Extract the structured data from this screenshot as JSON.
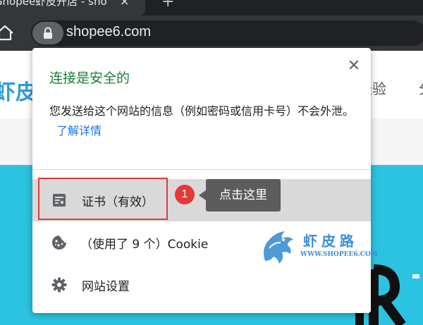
{
  "browser": {
    "tab_title": "Shopee虾皮开店 - sho",
    "tab_close": "×",
    "new_tab": "+",
    "url": "shopee6.com",
    "icons": {
      "home": "home-icon",
      "lock": "lock-icon"
    }
  },
  "site": {
    "logo_text": "虾皮",
    "nav_item": "经验",
    "nav_item_2": "分"
  },
  "popup": {
    "title": "连接是安全的",
    "title_color": "#188038",
    "close": "✕",
    "description": "您发送给这个网站的信息（例如密码或信用卡号）不会外泄。",
    "learn_more": "了解详情",
    "items": [
      {
        "icon": "certificate-icon",
        "label": "证书（有效）"
      },
      {
        "icon": "cookie-icon",
        "label": "（使用了 9 个）Cookie"
      },
      {
        "icon": "gear-icon",
        "label": "网站设置"
      }
    ]
  },
  "annotation": {
    "step_number": "1",
    "callout_text": "点击这里",
    "accent": "#e53935"
  },
  "watermark": {
    "name": "虾皮路",
    "url": "WWW.SHOPEE6.COM"
  }
}
